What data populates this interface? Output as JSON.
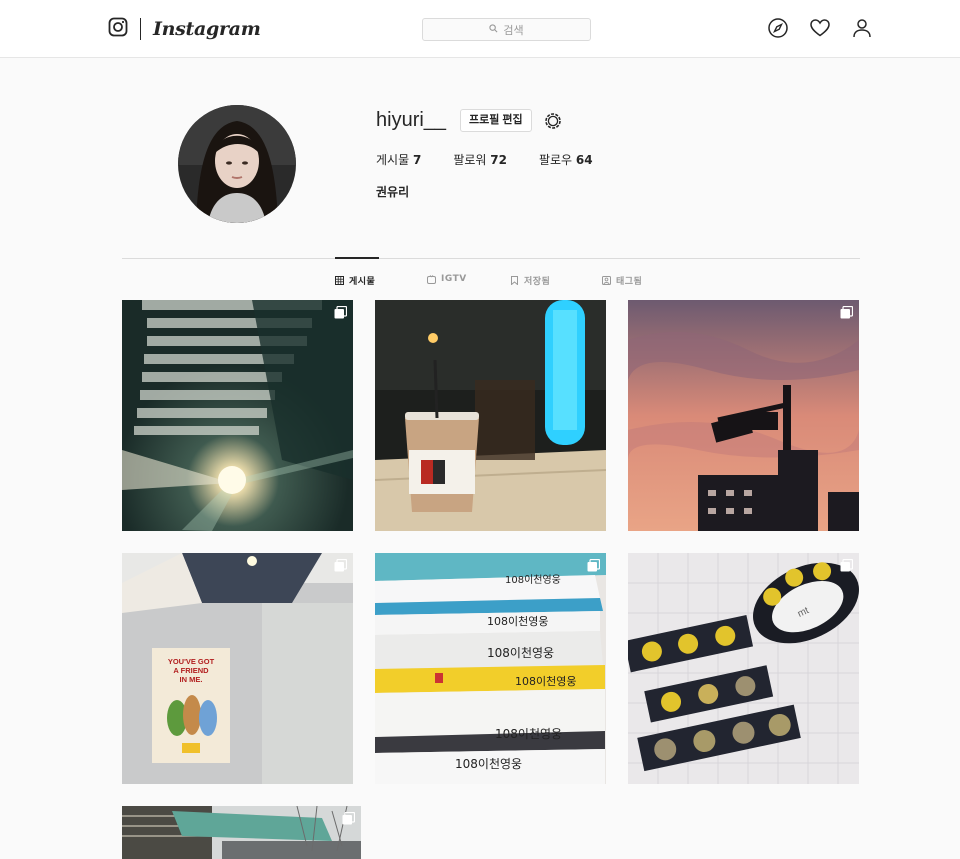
{
  "nav": {
    "logo_text": "Instagram",
    "search_placeholder": "검색",
    "icons": [
      "compass-icon",
      "heart-icon",
      "person-icon"
    ]
  },
  "profile": {
    "username": "hiyuri__",
    "edit_button": "프로필 편집",
    "stats": {
      "posts_label": "게시물",
      "posts": "7",
      "followers_label": "팔로워",
      "followers": "72",
      "following_label": "팔로우",
      "following": "64"
    },
    "full_name": "권유리"
  },
  "tabs": [
    {
      "label": "게시물",
      "icon": "grid-icon",
      "active": true
    },
    {
      "label": "IGTV",
      "icon": "igtv-icon",
      "active": false
    },
    {
      "label": "저장됨",
      "icon": "bookmark-icon",
      "active": false
    },
    {
      "label": "태그됨",
      "icon": "tag-icon",
      "active": false
    }
  ],
  "posts": {
    "p4_poster_text": "YOU'VE GOT A FRIEND IN ME.",
    "p5_book_text": "108이천영웅",
    "p6_tape_text": "mt"
  }
}
